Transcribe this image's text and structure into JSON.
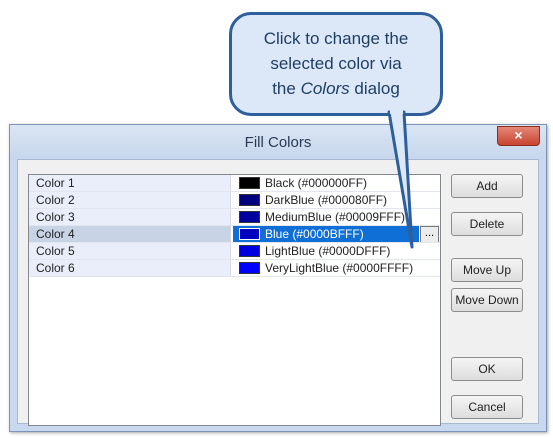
{
  "callout": {
    "line1": "Click to change the",
    "line2": "selected color via",
    "line3_prefix": "the ",
    "line3_italic": "Colors",
    "line3_suffix": " dialog"
  },
  "dialog": {
    "title": "Fill Colors",
    "close_label": "×",
    "rows": [
      {
        "name": "Color 1",
        "swatch": "#000000",
        "value": "Black (#000000FF)"
      },
      {
        "name": "Color 2",
        "swatch": "#000080",
        "value": "DarkBlue (#000080FF)"
      },
      {
        "name": "Color 3",
        "swatch": "#00009F",
        "value": "MediumBlue (#00009FFF)"
      },
      {
        "name": "Color 4",
        "swatch": "#0000BF",
        "value": "Blue (#0000BFFF)",
        "selected": true
      },
      {
        "name": "Color 5",
        "swatch": "#0000DF",
        "value": "LightBlue (#0000DFFF)"
      },
      {
        "name": "Color 6",
        "swatch": "#0000FF",
        "value": "VeryLightBlue (#0000FFFF)"
      }
    ],
    "ellipsis_label": "...",
    "buttons": {
      "add": "Add",
      "delete": "Delete",
      "move_up": "Move Up",
      "move_down": "Move Down",
      "ok": "OK",
      "cancel": "Cancel"
    }
  }
}
